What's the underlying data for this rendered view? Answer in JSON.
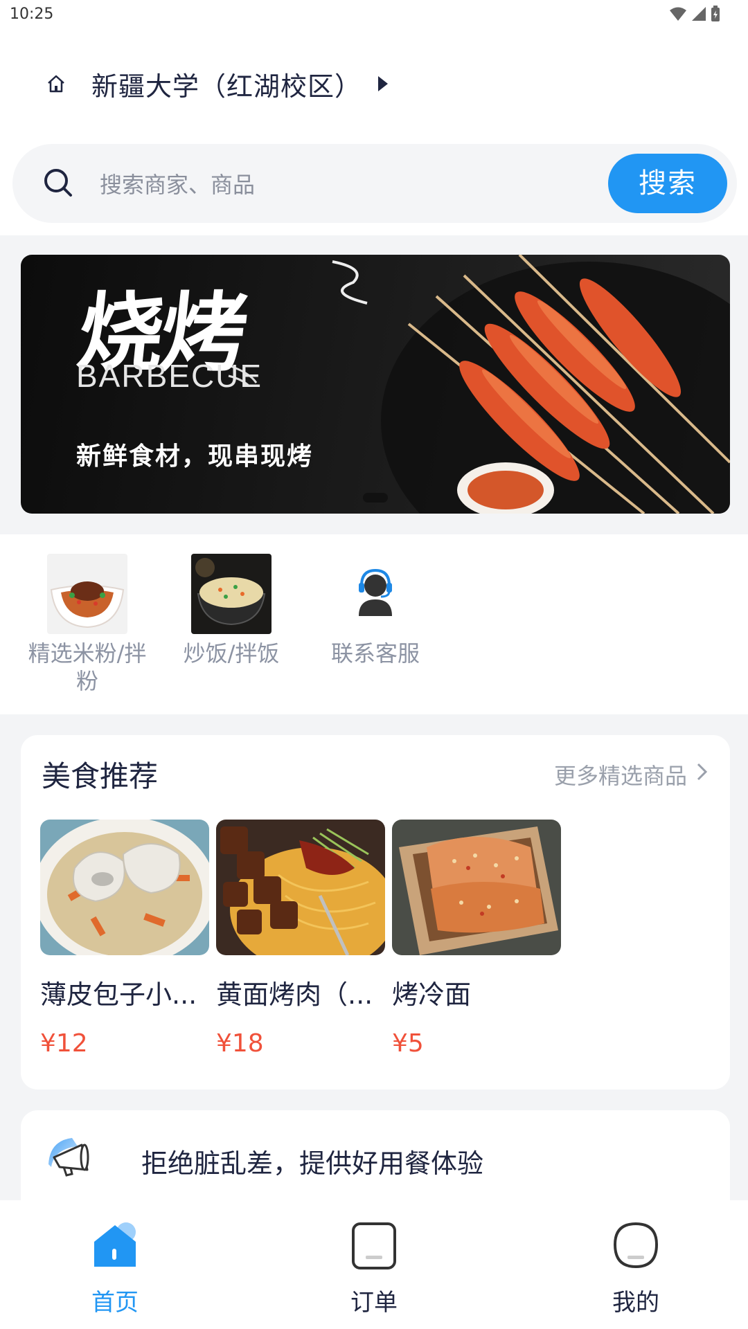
{
  "status_bar": {
    "time": "10:25"
  },
  "header": {
    "location": "新疆大学（红湖校区）"
  },
  "search": {
    "placeholder": "搜索商家、商品",
    "button": "搜索"
  },
  "banner": {
    "title": "烧烤",
    "subtitle": "BARBECUE",
    "slogan": "新鲜食材，现串现烤"
  },
  "categories": [
    {
      "label": "精选米粉/拌粉",
      "icon": "rice-noodle-bowl-photo"
    },
    {
      "label": "炒饭/拌饭",
      "icon": "fried-rice-bowl-photo"
    },
    {
      "label": "联系客服",
      "icon": "customer-service-icon"
    }
  ],
  "recommend": {
    "title": "美食推荐",
    "more": "更多精选商品",
    "items": [
      {
        "name": "薄皮包子小...",
        "price": "¥12"
      },
      {
        "name": "黄面烤肉（...",
        "price": "¥18"
      },
      {
        "name": "烤冷面",
        "price": "¥5"
      }
    ]
  },
  "notice": {
    "text": "拒绝脏乱差，提供好用餐体验"
  },
  "tabs": [
    {
      "label": "首页",
      "active": true
    },
    {
      "label": "订单",
      "active": false
    },
    {
      "label": "我的",
      "active": false
    }
  ],
  "colors": {
    "accent": "#2196f3",
    "price": "#f0513a",
    "text": "#1f2540",
    "muted": "#8c93a3"
  }
}
